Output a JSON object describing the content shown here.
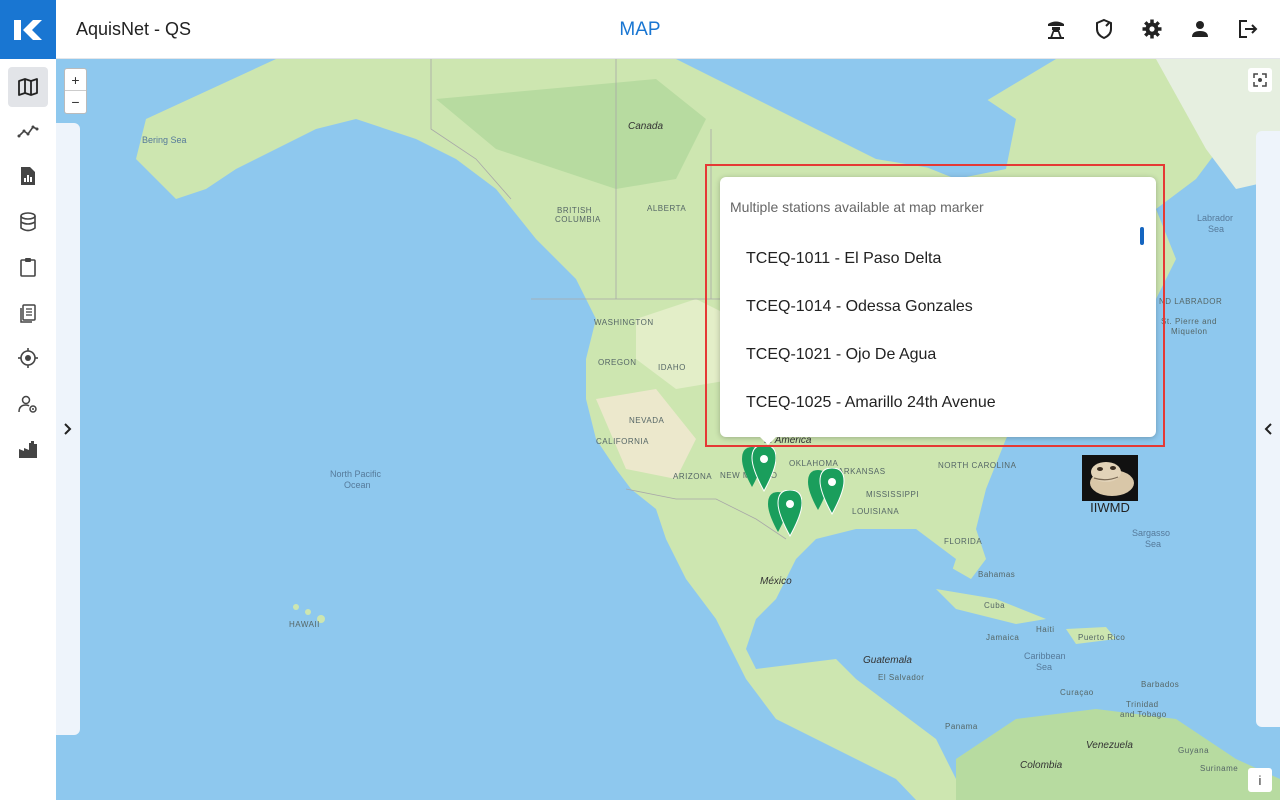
{
  "header": {
    "app_title": "AquisNet - QS",
    "page_title": "MAP",
    "icons": [
      "observation-tower-icon",
      "shield-icon",
      "gear-icon",
      "user-icon",
      "logout-icon"
    ]
  },
  "sidebar": {
    "items": [
      {
        "icon": "map-icon",
        "active": true
      },
      {
        "icon": "trend-chart-icon",
        "active": false
      },
      {
        "icon": "report-icon",
        "active": false
      },
      {
        "icon": "database-icon",
        "active": false
      },
      {
        "icon": "clipboard-icon",
        "active": false
      },
      {
        "icon": "layers-list-icon",
        "active": false
      },
      {
        "icon": "target-icon",
        "active": false
      },
      {
        "icon": "user-settings-icon",
        "active": false
      },
      {
        "icon": "factory-icon",
        "active": false
      }
    ]
  },
  "map": {
    "zoom_in": "+",
    "zoom_out": "−",
    "info": "i",
    "labels": {
      "canada": "Canada",
      "bering_sea_1": "Bering Sea",
      "british_columbia_1": "BRITISH",
      "british_columbia_2": "COLUMBIA",
      "alberta": "ALBERTA",
      "washington": "WASHINGTON",
      "oregon": "OREGON",
      "idaho": "IDAHO",
      "nevada": "NEVADA",
      "california": "CALIFORNIA",
      "arizona": "ARIZONA",
      "new_mexico": "NEW MEXICO",
      "oklahoma": "OKLAHOMA",
      "arkansas": "ARKANSAS",
      "mississippi": "MISSISSIPPI",
      "louisiana": "LOUISIANA",
      "north_carolina": "NORTH CAROLINA",
      "florida": "FLORIDA",
      "north_america": "th America",
      "north_pacific_1": "North Pacific",
      "north_pacific_2": "Ocean",
      "mexico": "México",
      "hawaii": "HAWAII",
      "labrador_sea_1": "Labrador",
      "labrador_sea_2": "Sea",
      "labrador": "ND LABRADOR",
      "st_pierre_1": "St. Pierre and",
      "st_pierre_2": "Miquelon",
      "sargasso_1": "Sargasso",
      "sargasso_2": "Sea",
      "bahamas": "Bahamas",
      "cuba": "Cuba",
      "jamaica": "Jamaica",
      "haiti": "Haiti",
      "puerto_rico": "Puerto Rico",
      "caribbean_1": "Caribbean",
      "caribbean_2": "Sea",
      "guatemala": "Guatemala",
      "el_salvador": "El Salvador",
      "curacao": "Curaçao",
      "barbados": "Barbados",
      "trinidad_1": "Trinidad",
      "trinidad_2": "and Tobago",
      "panama": "Panama",
      "venezuela": "Venezuela",
      "colombia": "Colombia",
      "suriname": "Suriname",
      "guyana": "Guyana",
      "north_carolina_short": "NORTH CAROLINA"
    },
    "custom_marker_label": "IIWMD",
    "marker_color": "#1a9e5c"
  },
  "popup": {
    "heading": "Multiple stations available at map marker",
    "stations": [
      "TCEQ-1011 - El Paso Delta",
      "TCEQ-1014 - Odessa Gonzales",
      "TCEQ-1021 - Ojo De Agua",
      "TCEQ-1025 - Amarillo 24th Avenue"
    ]
  },
  "colors": {
    "accent": "#1976d2",
    "highlight": "#e53935",
    "water": "#8ec8ee",
    "land": "#cde6b0"
  }
}
